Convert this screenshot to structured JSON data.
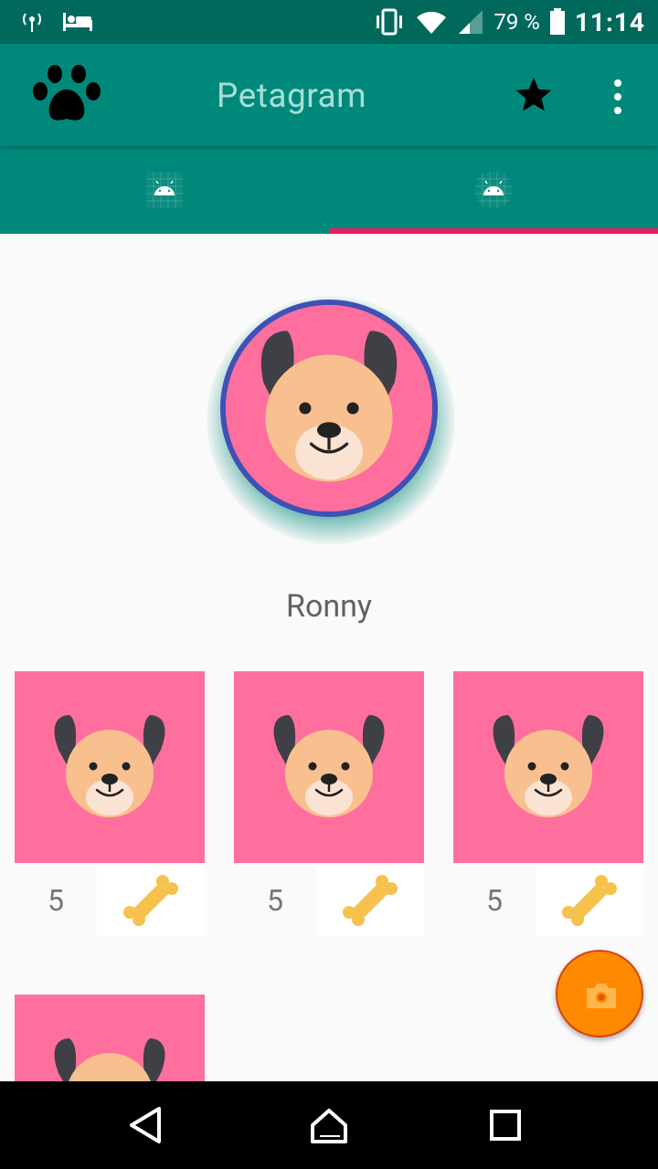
{
  "status_bar": {
    "battery_percent": "79 %",
    "time": "11:14"
  },
  "app_bar": {
    "title": "Petagram"
  },
  "tabs": [
    {
      "icon": "android-icon",
      "selected": false
    },
    {
      "icon": "android-icon",
      "selected": true
    }
  ],
  "profile": {
    "name": "Ronny"
  },
  "photos": [
    {
      "likes": "5"
    },
    {
      "likes": "5"
    },
    {
      "likes": "5"
    },
    {
      "likes": ""
    }
  ],
  "colors": {
    "primary_dark": "#00695c",
    "primary": "#00897b",
    "accent": "#e91e63",
    "avatar_border": "#3f51b5",
    "photo_bg": "#ff6f9d",
    "fab": "#ff8a00"
  }
}
